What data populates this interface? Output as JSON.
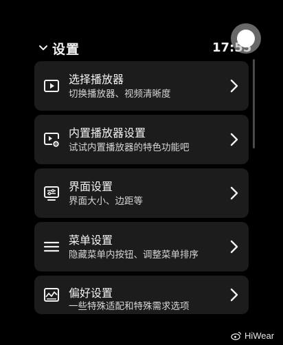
{
  "header": {
    "title": "设置",
    "time": "17:55"
  },
  "menu": [
    {
      "icon": "play-icon",
      "title": "选择播放器",
      "subtitle": "切换播放器、视频清晰度"
    },
    {
      "icon": "player-settings-icon",
      "title": "内置播放器设置",
      "subtitle": "试试内置播放器的特色功能吧"
    },
    {
      "icon": "interface-icon",
      "title": "界面设置",
      "subtitle": "界面大小、边距等"
    },
    {
      "icon": "menu-icon",
      "title": "菜单设置",
      "subtitle": "隐藏菜单内按钮、调整菜单排序"
    },
    {
      "icon": "preference-icon",
      "title": "偏好设置",
      "subtitle": "一些特殊适配和特殊需求选项"
    }
  ],
  "watermark": "HiWear"
}
